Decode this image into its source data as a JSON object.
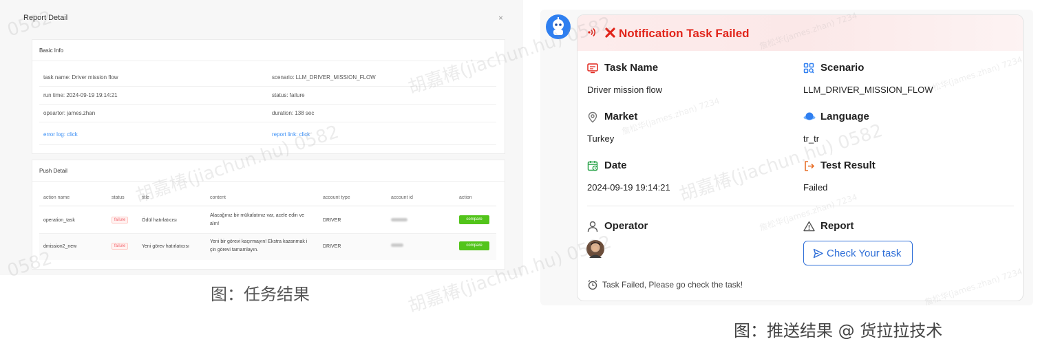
{
  "report": {
    "title": "Report Detail",
    "close": "×",
    "basic_info": {
      "header": "Basic Info",
      "task_name": "task name: Driver mission flow",
      "scenario": "scenario: LLM_DRIVER_MISSION_FLOW",
      "run_time": "run time: 2024-09-19 19:14:21",
      "status": "status: failure",
      "operator": "opeartor: james.zhan",
      "duration": "duration: 138 sec",
      "error_log": "error log: click",
      "report_link": "report link: click"
    },
    "push_detail": {
      "header": "Push Detail",
      "columns": [
        "action name",
        "status",
        "title",
        "content",
        "account type",
        "account id",
        "action"
      ],
      "rows": [
        {
          "action_name": "operation_task",
          "status": "failure",
          "title": "Ödül hatırlatıcısı",
          "content_1": "Alacağınız bir mükafatınız var, acele edin ve",
          "content_2": "alın!",
          "account_type": "DRIVER",
          "action": "compare"
        },
        {
          "action_name": "dmission2_new",
          "status": "failure",
          "title": "Yeni görev hatırlatıcısı",
          "content_1": "Yeni bir görevi kaçırmayın! Ekstra kazanmak i",
          "content_2": "çin görevi tamamlayın.",
          "account_type": "DRIVER",
          "action": "compare"
        }
      ]
    },
    "caption": "图：任务结果"
  },
  "notification": {
    "title": "Notification Task Failed",
    "fields": {
      "task_name_label": "Task Name",
      "task_name_value": "Driver mission flow",
      "scenario_label": "Scenario",
      "scenario_value": "LLM_DRIVER_MISSION_FLOW",
      "market_label": "Market",
      "market_value": "Turkey",
      "language_label": "Language",
      "language_value": "tr_tr",
      "date_label": "Date",
      "date_value": "2024-09-19 19:14:21",
      "result_label": "Test Result",
      "result_value": "Failed",
      "operator_label": "Operator",
      "report_label": "Report"
    },
    "button_label": "Check Your task",
    "footer": "Task Failed, Please go check the task!",
    "caption": "图：推送结果 @ 货拉拉技术"
  },
  "watermark": {
    "name": "胡嘉椿(jiachun.hu) 0582",
    "small": "詹松华(james.zhan) 7234",
    "digits": "0582"
  },
  "colors": {
    "error_red": "#e1251b",
    "link_blue": "#3b8ff5",
    "button_blue": "#2f6fd8",
    "compare_green": "#52c41a"
  }
}
